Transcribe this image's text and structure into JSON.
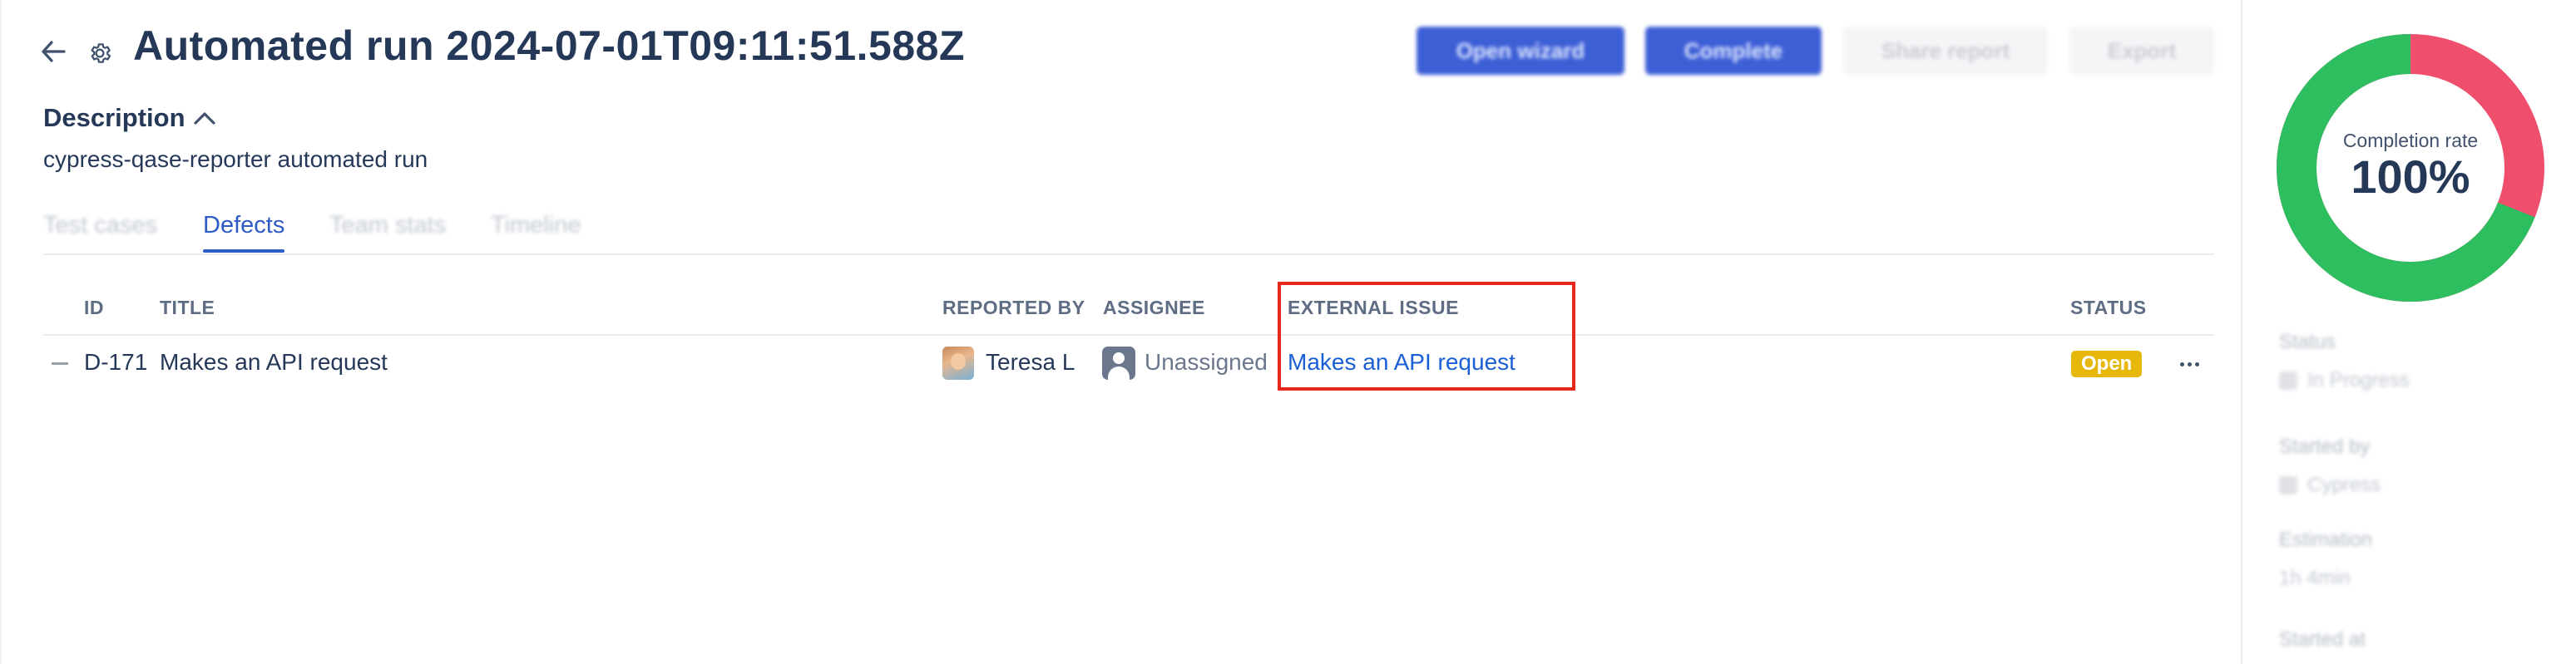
{
  "header": {
    "title": "Automated run 2024-07-01T09:11:51.588Z",
    "buttons": {
      "open_wizard": "Open wizard",
      "complete": "Complete",
      "share_report": "Share report",
      "export": "Export"
    }
  },
  "description": {
    "title": "Description",
    "text": "cypress-qase-reporter automated run"
  },
  "tabs": [
    {
      "label": "Test cases"
    },
    {
      "label": "Defects"
    },
    {
      "label": "Team stats"
    },
    {
      "label": "Timeline"
    }
  ],
  "active_tab": "Defects",
  "table": {
    "columns": {
      "id": "ID",
      "title": "TITLE",
      "reported_by": "REPORTED BY",
      "assignee": "ASSIGNEE",
      "external_issue": "EXTERNAL ISSUE",
      "status": "STATUS"
    },
    "rows": [
      {
        "id": "D-171",
        "title": "Makes an API request",
        "reported_by": "Teresa L",
        "assignee": "Unassigned",
        "external_issue": "Makes an API request",
        "status": "Open"
      }
    ]
  },
  "sidebar": {
    "completion_label": "Completion rate",
    "completion_value": "100%",
    "completion_fraction": 1.0,
    "meta": [
      {
        "label": "Status",
        "value": "In Progress"
      },
      {
        "label": "Started by",
        "value": "Cypress"
      },
      {
        "label": "Estimation",
        "value": "1h 4min"
      },
      {
        "label": "Started at",
        "value": ""
      }
    ]
  },
  "colors": {
    "donut_green": "#2dbe60",
    "donut_red": "#ef4e6d",
    "accent_blue": "#2e5bc6",
    "status_open": "#e5b80b",
    "highlight_red": "#e8271e"
  },
  "icons": [
    "arrow-left-icon",
    "gear-icon",
    "chevron-up-icon",
    "more-icon"
  ]
}
